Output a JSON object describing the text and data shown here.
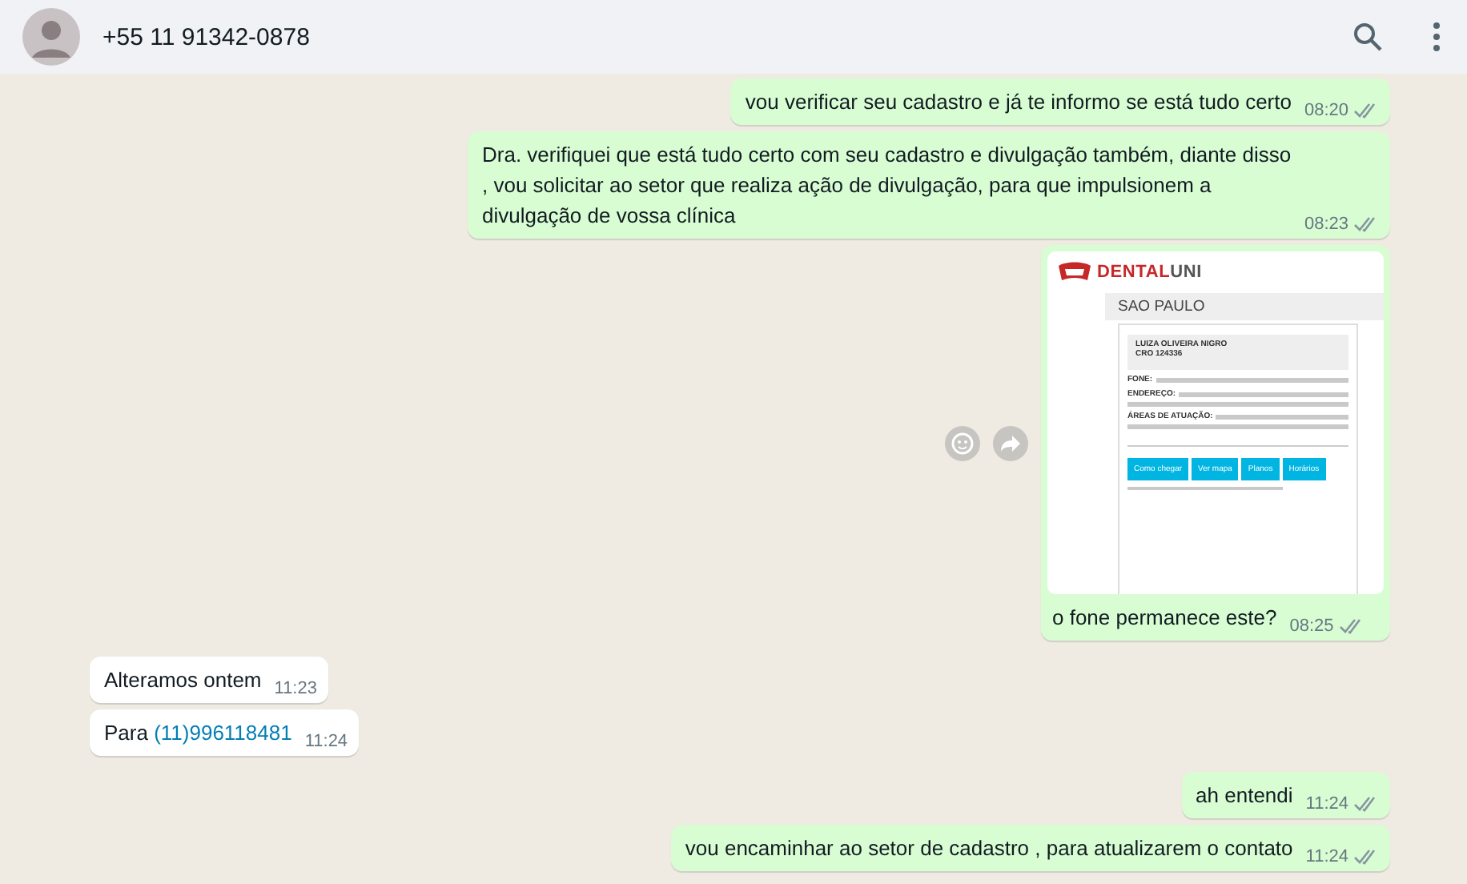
{
  "header": {
    "contact": "+55 11 91342-0878"
  },
  "messages": [
    {
      "kind": "out",
      "text": "vou verificar seu cadastro e já te informo se está tudo certo",
      "time": "08:20"
    },
    {
      "kind": "out",
      "text": "Dra. verifiquei que está tudo certo com seu cadastro e divulgação também, diante disso , vou solicitar ao setor que realiza ação de divulgação, para que impulsionem a divulgação de vossa clínica",
      "time": "08:23"
    },
    {
      "kind": "out",
      "text": "o fone permanece este?",
      "time": "08:25",
      "attachment": {
        "logo_a": "DENTAL",
        "logo_b": "UNI",
        "city": "SAO PAULO",
        "name": "LUIZA OLIVEIRA NIGRO",
        "cro": "CRO 124336",
        "fields": [
          "FONE:",
          "ENDEREÇO:",
          "ÁREAS DE ATUAÇÃO:"
        ],
        "buttons": [
          "Como chegar",
          "Ver mapa",
          "Planos",
          "Horários"
        ]
      }
    },
    {
      "kind": "in",
      "text": "Alteramos ontem",
      "time": "11:23"
    },
    {
      "kind": "in",
      "text": "Para ",
      "link": "(11)996118481",
      "time": "11:24"
    },
    {
      "kind": "out",
      "text": "ah entendi",
      "time": "11:24"
    },
    {
      "kind": "out",
      "text": "vou encaminhar ao setor de cadastro , para atualizarem o contato",
      "time": "11:24"
    }
  ]
}
